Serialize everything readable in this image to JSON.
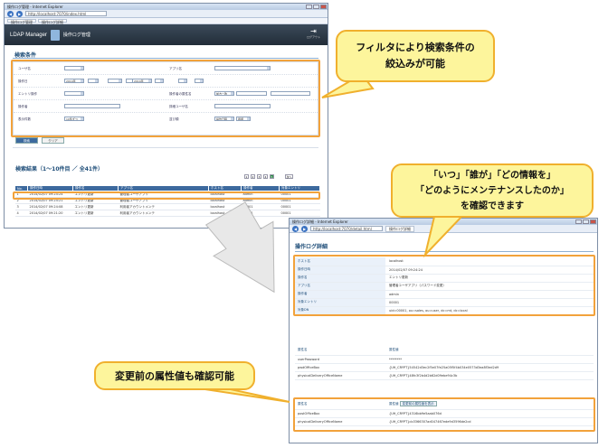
{
  "browser1": {
    "title": "操作ログ管理 - Internet Explorer",
    "address": "http://localhost:7070/index.html",
    "tabs": [
      "操作ログ管理",
      "操作ログ詳細"
    ]
  },
  "app": {
    "logo": "LDAP Manager",
    "module_title": "操作ログ管理",
    "logout": "ログアウト"
  },
  "search": {
    "title": "検索条件",
    "labels": {
      "who": "ユーザ名",
      "app": "アプリ名",
      "date": "操作日",
      "entry": "エントリ操作",
      "attr": "操作者の属性名",
      "target": "操作者",
      "message": "詳細ユーザ名",
      "count": "表示件数",
      "sort": "並び順"
    },
    "date_from": "2014年",
    "date_to": "2014年",
    "attr_option": "前方一致",
    "count_option": "10件ずつ",
    "sort_option_1": "操作日時",
    "sort_option_2": "昇順",
    "search_button": "検索",
    "clear_button": "クリア"
  },
  "results": {
    "title": "検索結果（1〜10件目 ／ 全41件）",
    "pages": [
      "1",
      "2",
      "3",
      "4",
      "5"
    ],
    "active_page": "1",
    "next_label": "次へ",
    "columns": [
      "No.",
      "操作日時",
      "操作名",
      "アプリ名",
      "ホスト名",
      "操作者",
      "対象エントリ"
    ],
    "rows": [
      [
        "1",
        "2014/02/07 09:24:24",
        "エントリ更新",
        "管理者ユーザアプリ",
        "localhost",
        "admin",
        "00001"
      ],
      [
        "2",
        "2014/02/07 09:24:21",
        "エントリ更新",
        "管理者ユーザアプリ",
        "localhost",
        "admin",
        "00001"
      ],
      [
        "3",
        "2014/02/07 09:24:08",
        "エントリ更新",
        "利用者アカウントメンテ",
        "localhost",
        "00001",
        "00001"
      ],
      [
        "4",
        "2014/02/07 09:21:20",
        "エントリ更新",
        "利用者アカウントメンテ",
        "localhost",
        "00001",
        "00001"
      ]
    ]
  },
  "browser2": {
    "title": "操作ログ詳細 - Internet Explorer",
    "address": "http://localhost:7070/detail.html",
    "tab": "操作ログ詳細"
  },
  "detail": {
    "title": "操作ログ詳細",
    "fields": [
      {
        "k": "ホスト名",
        "v": "localhost"
      },
      {
        "k": "操作日時",
        "v": "2014/02/07 09:24:24"
      },
      {
        "k": "操作名",
        "v": "エントリ更新"
      },
      {
        "k": "アプリ名",
        "v": "管理者ユーザアプリ（パスワード変更）"
      },
      {
        "k": "操作者",
        "v": "admin"
      },
      {
        "k": "対象エントリ",
        "v": "00001"
      },
      {
        "k": "対象DN",
        "v": "uid=00001, ou=sales, ou=user, dc=mt, dc=local"
      }
    ],
    "attr_header_name": "属性名",
    "attr_header_value": "属性値",
    "attrs_after": [
      {
        "k": "userPassword",
        "v": "********"
      },
      {
        "k": "pwdOfficeBox",
        "v": "{UH_CRYPT}54542d3ec2f5e07fe25a05f5f4b034e0573d3ea8f3ed2d9"
      },
      {
        "k": "physicalDeliveryOfficeName",
        "v": "{UH_CRYPT}48fc3f2b4d2b62d09ebe94c3b"
      }
    ],
    "before_header_name": "属性名",
    "before_header_value": "属性値",
    "before_toggle": "変更前の属性値を表示",
    "attrs_before": [
      {
        "k": "postOfficeBox",
        "v": "{UH_CRYPT}4316bb9e5aab076d"
      },
      {
        "k": "physicalDeliveryOfficeName",
        "v": "{UH_CRYPT}cb3366307ad047467ede9d3596de2cd"
      }
    ]
  },
  "callouts": {
    "filter": [
      "フィルタにより検索条件の",
      "絞込みが可能"
    ],
    "detail": [
      "「いつ」「誰が」「どの情報を」",
      "「どのようにメンテナンスしたのか」",
      "を確認できます"
    ],
    "before": [
      "変更前の属性値も確認可能"
    ]
  },
  "colors": {
    "callout_fill": "#fdf59c",
    "callout_border": "#f0b02d",
    "highlight": "#f2a23b",
    "header": "#3d6a9e"
  }
}
